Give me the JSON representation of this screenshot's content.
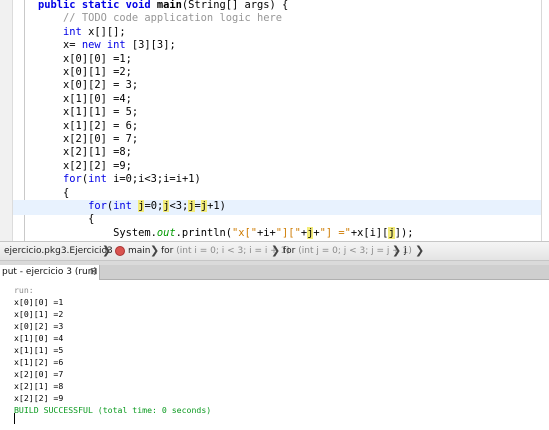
{
  "editor": {
    "lines": [
      {
        "indent": "    ",
        "parts": [
          {
            "t": "public static void ",
            "c": "kwb"
          },
          {
            "t": "main",
            "c": "b"
          },
          {
            "t": "(String[] args) {",
            "c": ""
          }
        ]
      },
      {
        "indent": "        ",
        "parts": [
          {
            "t": "// TODO code application logic here",
            "c": "cm"
          }
        ]
      },
      {
        "indent": "        ",
        "parts": [
          {
            "t": "int",
            "c": "kw"
          },
          {
            "t": " x[][];",
            "c": ""
          }
        ]
      },
      {
        "indent": "        ",
        "parts": [
          {
            "t": "x= ",
            "c": ""
          },
          {
            "t": "new",
            "c": "kw"
          },
          {
            "t": " ",
            "c": ""
          },
          {
            "t": "int",
            "c": "kw"
          },
          {
            "t": " [3][3];",
            "c": ""
          }
        ]
      },
      {
        "indent": "        ",
        "parts": [
          {
            "t": "x[0][0] =1;",
            "c": ""
          }
        ]
      },
      {
        "indent": "        ",
        "parts": [
          {
            "t": "x[0][1] =2;",
            "c": ""
          }
        ]
      },
      {
        "indent": "        ",
        "parts": [
          {
            "t": "x[0][2] = 3;",
            "c": ""
          }
        ]
      },
      {
        "indent": "        ",
        "parts": [
          {
            "t": "x[1][0] =4;",
            "c": ""
          }
        ]
      },
      {
        "indent": "        ",
        "parts": [
          {
            "t": "x[1][1] = 5;",
            "c": ""
          }
        ]
      },
      {
        "indent": "        ",
        "parts": [
          {
            "t": "x[1][2] = 6;",
            "c": ""
          }
        ]
      },
      {
        "indent": "        ",
        "parts": [
          {
            "t": "x[2][0] = 7;",
            "c": ""
          }
        ]
      },
      {
        "indent": "        ",
        "parts": [
          {
            "t": "x[2][1] =8;",
            "c": ""
          }
        ]
      },
      {
        "indent": "        ",
        "parts": [
          {
            "t": "x[2][2] =9;",
            "c": ""
          }
        ]
      },
      {
        "indent": "        ",
        "parts": [
          {
            "t": "for",
            "c": "kw"
          },
          {
            "t": "(",
            "c": ""
          },
          {
            "t": "int",
            "c": "kw"
          },
          {
            "t": " i=0;i<3;i=i+1)",
            "c": ""
          }
        ]
      },
      {
        "indent": "        ",
        "parts": [
          {
            "t": "{",
            "c": ""
          }
        ]
      },
      {
        "indent": "            ",
        "parts": [
          {
            "t": "for",
            "c": "kw"
          },
          {
            "t": "(",
            "c": ""
          },
          {
            "t": "int",
            "c": "kw"
          },
          {
            "t": " ",
            "c": ""
          },
          {
            "t": "j",
            "c": "hj"
          },
          {
            "t": "=0;",
            "c": ""
          },
          {
            "t": "j",
            "c": "hj"
          },
          {
            "t": "<3;",
            "c": ""
          },
          {
            "t": "j",
            "c": "hj"
          },
          {
            "t": "=",
            "c": ""
          },
          {
            "t": "j",
            "c": "hj"
          },
          {
            "t": "+1)",
            "c": ""
          }
        ]
      },
      {
        "indent": "            ",
        "parts": [
          {
            "t": "{",
            "c": ""
          }
        ]
      },
      {
        "indent": "                ",
        "parts": [
          {
            "t": "System.",
            "c": ""
          },
          {
            "t": "out",
            "c": "fld"
          },
          {
            "t": ".println(",
            "c": ""
          },
          {
            "t": "\"x[\"",
            "c": "str"
          },
          {
            "t": "+i+",
            "c": ""
          },
          {
            "t": "\"][\"",
            "c": "str"
          },
          {
            "t": "+",
            "c": ""
          },
          {
            "t": "j",
            "c": "hj"
          },
          {
            "t": "+",
            "c": ""
          },
          {
            "t": "\"] =\"",
            "c": "str"
          },
          {
            "t": "+x[i][",
            "c": ""
          },
          {
            "t": "j",
            "c": "hj"
          },
          {
            "t": "]);",
            "c": ""
          }
        ]
      }
    ]
  },
  "breadcrumb": {
    "class_label": "ejercicio.pkg3.Ejercicio3",
    "method_label": "main",
    "for1_keyword": "for",
    "for1_detail": "(int i = 0; i < 3; i = i + 1)",
    "for2_keyword": "for",
    "for2_detail": "(int j = 0; j < 3; j = j + 1)",
    "var_label": "j",
    "separator": "❯"
  },
  "output": {
    "tab_label": "put - ejercicio 3 (run)",
    "close_glyph": "⊠",
    "lines": [
      {
        "t": "run:",
        "c": "out-run"
      },
      {
        "t": "x[0][0] =1",
        "c": ""
      },
      {
        "t": "x[0][1] =2",
        "c": ""
      },
      {
        "t": "x[0][2] =3",
        "c": ""
      },
      {
        "t": "x[1][0] =4",
        "c": ""
      },
      {
        "t": "x[1][1] =5",
        "c": ""
      },
      {
        "t": "x[1][2] =6",
        "c": ""
      },
      {
        "t": "x[2][0] =7",
        "c": ""
      },
      {
        "t": "x[2][1] =8",
        "c": ""
      },
      {
        "t": "x[2][2] =9",
        "c": ""
      },
      {
        "t": "BUILD SUCCESSFUL (total time: 0 seconds)",
        "c": "out-ok"
      }
    ]
  }
}
